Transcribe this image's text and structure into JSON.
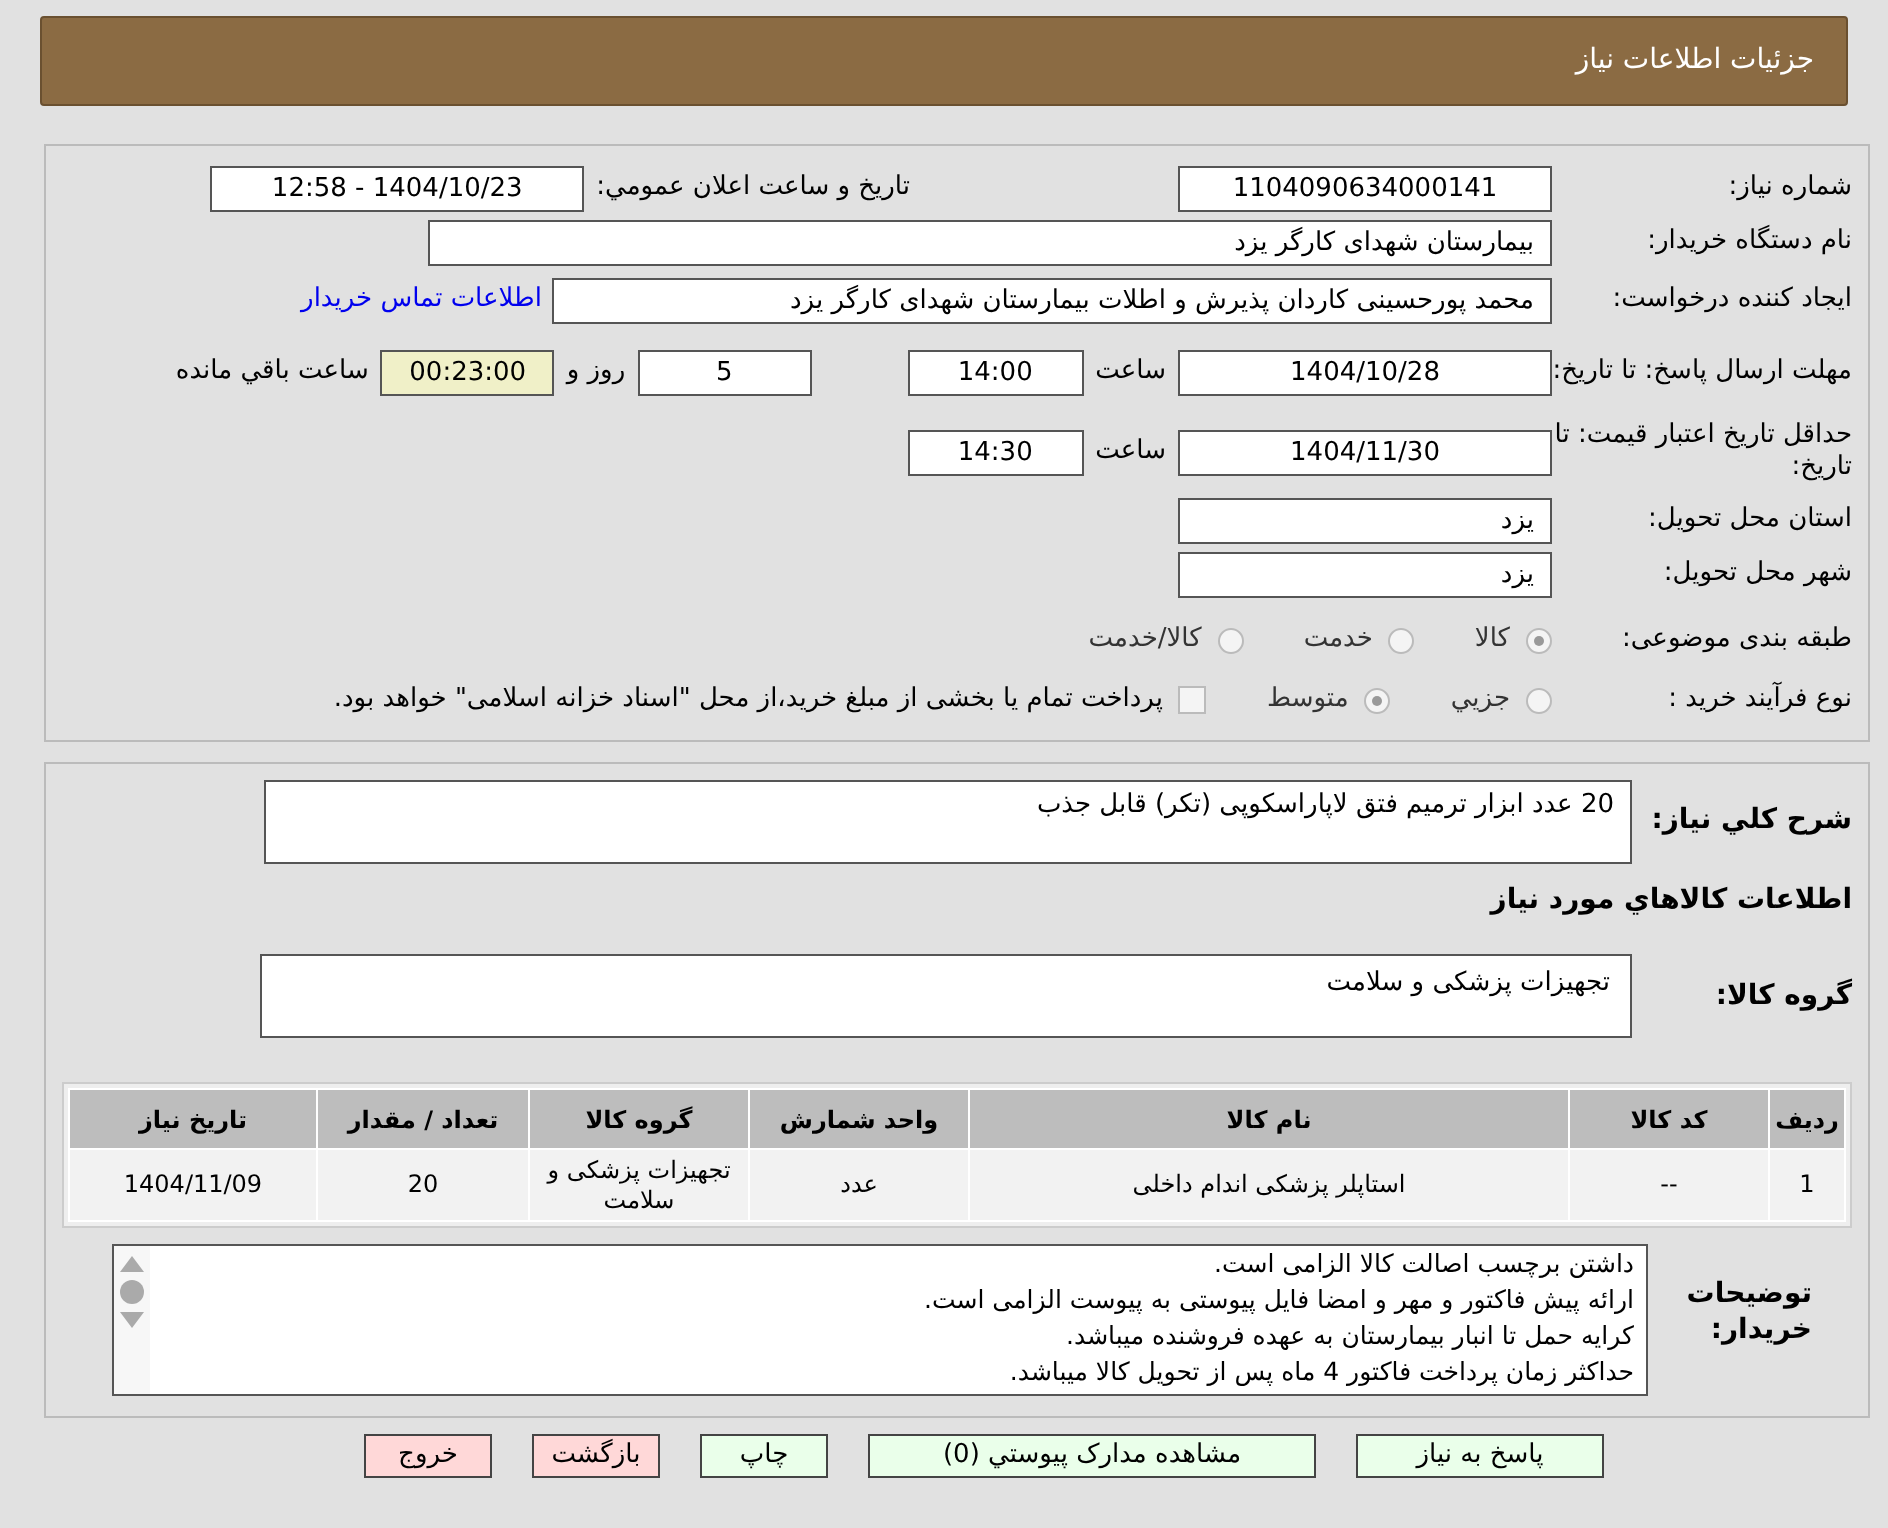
{
  "header": {
    "title": "جزئیات اطلاعات نیاز"
  },
  "need_number": {
    "label": "شماره نیاز:",
    "value": "1104090634000141"
  },
  "announce": {
    "label": "تاریخ و ساعت اعلان عمومي:",
    "value": "1404/10/23 - 12:58"
  },
  "buyer_org": {
    "label": "نام دستگاه خریدار:",
    "value": "بیمارستان شهدای کارگر یزد"
  },
  "requester": {
    "label": "ایجاد کننده درخواست:",
    "value": "محمد پورحسینی کاردان پذیرش و اطلات بیمارستان شهدای کارگر یزد",
    "link": "اطلاعات تماس خریدار"
  },
  "deadline": {
    "label": "مهلت ارسال پاسخ: تا تاریخ:",
    "date": "1404/10/28",
    "time_label": "ساعت",
    "time": "14:00",
    "days": "5",
    "days_label": "روز و",
    "remaining": "00:23:00",
    "remaining_label": "ساعت باقي مانده"
  },
  "validity": {
    "label": "حداقل تاریخ اعتبار قیمت: تا تاریخ:",
    "date": "1404/11/30",
    "time_label": "ساعت",
    "time": "14:30"
  },
  "province": {
    "label": "استان محل تحویل:",
    "value": "یزد"
  },
  "city": {
    "label": "شهر محل تحویل:",
    "value": "یزد"
  },
  "category": {
    "label": "طبقه بندی موضوعی:",
    "options": [
      {
        "label": "کالا",
        "selected": true
      },
      {
        "label": "خدمت",
        "selected": false
      },
      {
        "label": "کالا/خدمت",
        "selected": false
      }
    ]
  },
  "process": {
    "label": "نوع فرآیند خرید :",
    "options": [
      {
        "label": "جزيي",
        "selected": false
      },
      {
        "label": "متوسط",
        "selected": true
      }
    ],
    "payment_note": {
      "checked": false,
      "text": "پرداخت تمام یا بخشی از مبلغ خرید،از محل \"اسناد خزانه اسلامی\" خواهد بود."
    }
  },
  "description": {
    "label": "شرح کلي نیاز:",
    "value": "20 عدد ابزار ترمیم فتق لاپاراسکوپی (تکر) قابل جذب"
  },
  "items_title": "اطلاعات کالاهاي مورد نیاز",
  "goods_group": {
    "label": "گروه کالا:",
    "value": "تجهیزات پزشکی و سلامت"
  },
  "table": {
    "columns": [
      "ردیف",
      "کد کالا",
      "نام کالا",
      "واحد شمارش",
      "گروه کالا",
      "تعداد / مقدار",
      "تاریخ نیاز"
    ],
    "rows": [
      [
        "1",
        "--",
        "استاپلر پزشکی اندام داخلی",
        "عدد",
        "تجهیزات پزشکی و سلامت",
        "20",
        "1404/11/09"
      ]
    ]
  },
  "buyer_notes": {
    "label": "توضیحات خریدار:",
    "lines": [
      "داشتن برچسب اصالت کالا الزامی است.",
      "ارائه پیش فاکتور و مهر و امضا فایل پیوستی به پیوست الزامی است.",
      "کرایه حمل تا انبار بیمارستان به عهده فروشنده میباشد.",
      "حداکثر زمان پرداخت فاکتور 4 ماه پس از تحویل کالا میباشد."
    ]
  },
  "buttons": [
    {
      "label": "پاسخ به نیاز",
      "kind": "action"
    },
    {
      "label": "مشاهده مدارک پیوستي (0)",
      "kind": "action"
    },
    {
      "label": "چاپ",
      "kind": "action"
    },
    {
      "label": "بازگشت",
      "kind": "exit"
    },
    {
      "label": "خروج",
      "kind": "exit"
    }
  ]
}
